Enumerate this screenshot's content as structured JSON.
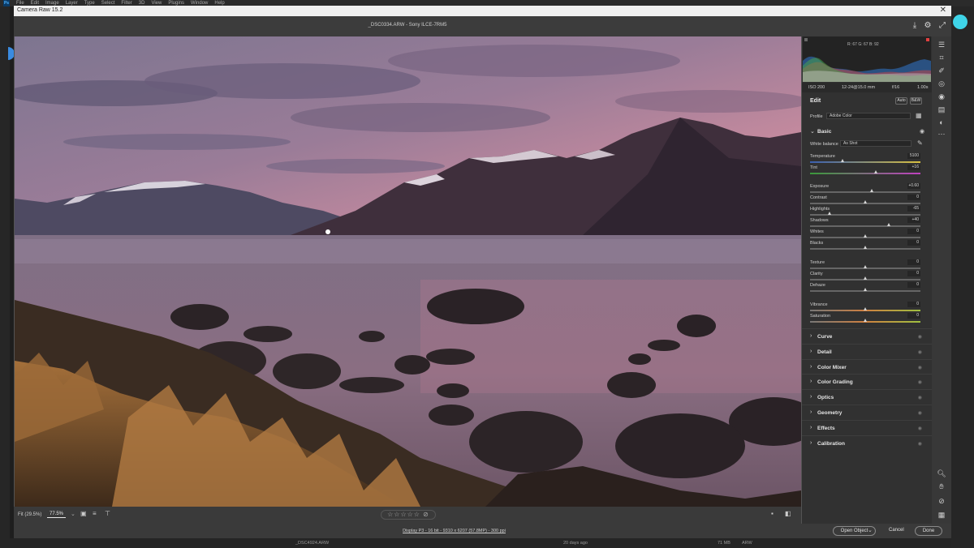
{
  "photoshop": {
    "menu": [
      "File",
      "Edit",
      "Image",
      "Layer",
      "Type",
      "Select",
      "Filter",
      "3D",
      "View",
      "Plugins",
      "Window",
      "Help"
    ],
    "bottom_file": "_DSC4924.ARW",
    "bottom_date": "20 days ago",
    "bottom_size": "71 MB",
    "bottom_type": "ARW"
  },
  "dialog": {
    "title": "Camera Raw 15.2",
    "file_info": "_DSC0334.ARW  -  Sony ILCE-7RM5"
  },
  "image_bar": {
    "zoom_fit": "Fit (29.5%)",
    "zoom_level": "77.5%",
    "stars": "☆☆☆☆☆  ⊘"
  },
  "status": {
    "workflow_link": "Display P3 - 16 bit - 9310 x 6207 (57.8MP) - 300 ppi",
    "open_object": "Open Object",
    "cancel": "Cancel",
    "done": "Done"
  },
  "histogram": {
    "readout": "R: 67   G: 67   B: 92"
  },
  "camera_info": {
    "iso": "ISO 200",
    "focal": "12-24@15.0 mm",
    "aperture": "f/16",
    "shutter": "1.00s"
  },
  "edit": {
    "title": "Edit",
    "auto": "Auto",
    "bw": "B&W",
    "profile_label": "Profile",
    "profile_value": "Adobe Color",
    "basic_title": "Basic",
    "wb_label": "White balance",
    "wb_value": "As Shot"
  },
  "sliders": [
    {
      "label": "Temperature",
      "value": "5100",
      "pos": 0.3,
      "gradient": "linear-gradient(90deg,#3a5fb0,#d8c040)"
    },
    {
      "label": "Tint",
      "value": "+16",
      "pos": 0.6,
      "gradient": "linear-gradient(90deg,#3a9a3a,#c040c0)"
    },
    {
      "label": "Exposure",
      "value": "+0.60",
      "pos": 0.56,
      "gradient": ""
    },
    {
      "label": "Contrast",
      "value": "0",
      "pos": 0.5,
      "gradient": ""
    },
    {
      "label": "Highlights",
      "value": "-65",
      "pos": 0.18,
      "gradient": ""
    },
    {
      "label": "Shadows",
      "value": "+40",
      "pos": 0.72,
      "gradient": ""
    },
    {
      "label": "Whites",
      "value": "0",
      "pos": 0.5,
      "gradient": ""
    },
    {
      "label": "Blacks",
      "value": "0",
      "pos": 0.5,
      "gradient": ""
    },
    {
      "label": "Texture",
      "value": "0",
      "pos": 0.5,
      "gradient": ""
    },
    {
      "label": "Clarity",
      "value": "0",
      "pos": 0.5,
      "gradient": ""
    },
    {
      "label": "Dehaze",
      "value": "0",
      "pos": 0.5,
      "gradient": ""
    },
    {
      "label": "Vibrance",
      "value": "0",
      "pos": 0.5,
      "gradient": "linear-gradient(90deg,#777,#d08040,#a0c040)"
    },
    {
      "label": "Saturation",
      "value": "0",
      "pos": 0.5,
      "gradient": "linear-gradient(90deg,#777,#d08040,#a0c040)"
    }
  ],
  "sections": [
    "Curve",
    "Detail",
    "Color Mixer",
    "Color Grading",
    "Optics",
    "Geometry",
    "Effects",
    "Calibration"
  ],
  "colors": {
    "accent": "#3fd4e8",
    "panel": "#313131",
    "dialog": "#535353"
  }
}
